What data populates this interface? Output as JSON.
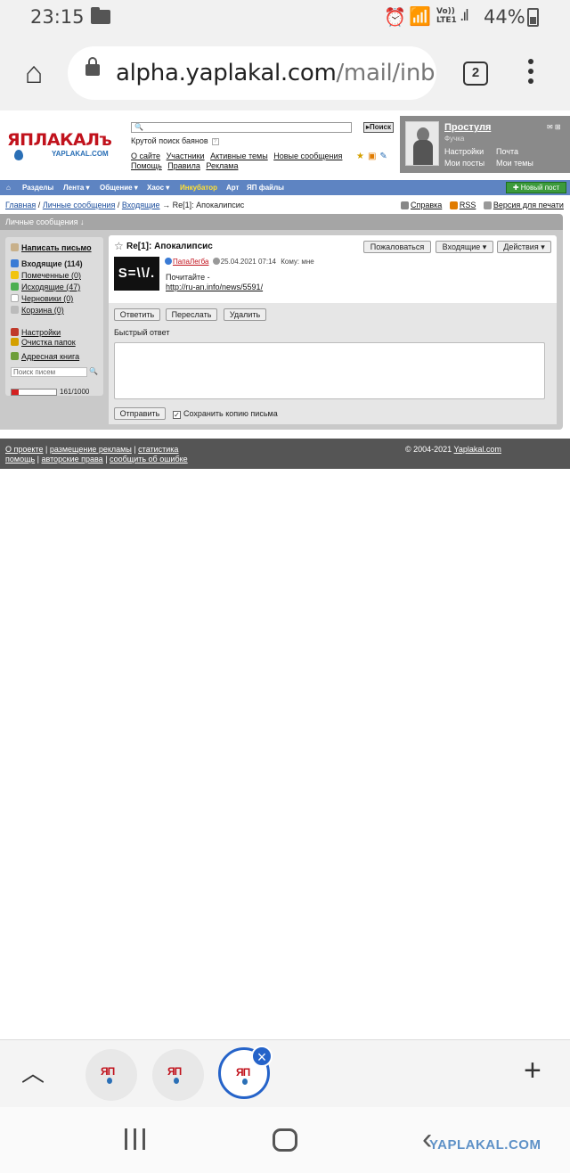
{
  "status_bar": {
    "time": "23:15",
    "lte_line1": "Vo))",
    "lte_line2": "LTE1",
    "battery_percent": "44%",
    "battery_level": 0.44
  },
  "browser": {
    "url_host": "alpha.yaplakal.com",
    "url_path": "/mail/inb",
    "tab_count": "2",
    "home_icon": "home-icon",
    "lock_icon": "lock-icon",
    "menu_icon": "more-vertical-icon"
  },
  "site": {
    "logo_text": "ЯПЛАКАЛъ",
    "logo_subtext": "YAPLAKAL.COM",
    "search_button": "Поиск",
    "search_hint": "Крутой поиск баянов",
    "top_links": [
      "О сайте",
      "Участники",
      "Активные темы",
      "Новые сообщения",
      "Помощь",
      "Правила",
      "Реклама"
    ],
    "user": {
      "name": "Простуля",
      "rank": "Фучка",
      "links": [
        "Настройки",
        "Почта",
        "Мои посты",
        "Мои темы"
      ]
    },
    "nav": [
      "Разделы",
      "Лента ▾",
      "Общение ▾",
      "Хаос ▾",
      "Инкубатор",
      "Арт",
      "ЯП файлы"
    ],
    "new_post": "Новый пост",
    "breadcrumb": {
      "home": "Главная",
      "pm": "Личные сообщения",
      "inbox": "Входящие",
      "current": "→ Re[1]: Апокалипсис",
      "sep": "/"
    },
    "util_links": [
      "Справка",
      "RSS",
      "Версия для печати"
    ],
    "pm_bar_title": "Личные сообщения ↓",
    "sidebar": {
      "compose": "Написать письмо",
      "folders": [
        {
          "label": "Входящие (114)",
          "bold": true,
          "color": "#3a7bd5"
        },
        {
          "label": "Помеченные (0)",
          "bold": false,
          "color": "#f1c40f"
        },
        {
          "label": "Исходящие (47)",
          "bold": false,
          "color": "#4caf50"
        },
        {
          "label": "Черновики (0)",
          "bold": false,
          "color": "#ffffff"
        },
        {
          "label": "Корзина (0)",
          "bold": false,
          "color": "#bbbbbb"
        }
      ],
      "settings": "Настройки",
      "clean": "Очистка папок",
      "address_book": "Адресная книга",
      "search_placeholder": "Поиск писем",
      "quota_text": "161/1000",
      "quota_fraction": 0.161
    },
    "message": {
      "title": "Re[1]: Апокалипсис",
      "buttons": [
        "Пожаловаться",
        "Входящие ▾",
        "Действия ▾"
      ],
      "avatar_text": "S=\\\\/.",
      "author": "ПапаЛегба",
      "date": "25.04.2021 07:14",
      "to": "Кому: мне",
      "body_line": "Почитайте -",
      "link": "http://ru-an.info/news/5591/"
    },
    "actions": {
      "reply": "Ответить",
      "forward": "Переслать",
      "delete": "Удалить",
      "quick_reply_label": "Быстрый ответ",
      "send": "Отправить",
      "save_copy": "Сохранить копию письма",
      "save_copy_checked": true
    },
    "footer": {
      "row1": [
        "О проекте",
        "размещение рекламы",
        "статистика"
      ],
      "row2": [
        "помощь",
        "авторские права",
        "сообщить об ошибке"
      ],
      "copyright": "© 2004-2021",
      "copyright_link": "Yaplakal.com"
    }
  },
  "tab_strip": {
    "thumb_text": "ЯП",
    "collapse_icon": "chevron-up-icon",
    "new_tab_icon": "plus-icon",
    "close_icon": "close-icon"
  },
  "watermark": "YAPLAKAL.COM"
}
